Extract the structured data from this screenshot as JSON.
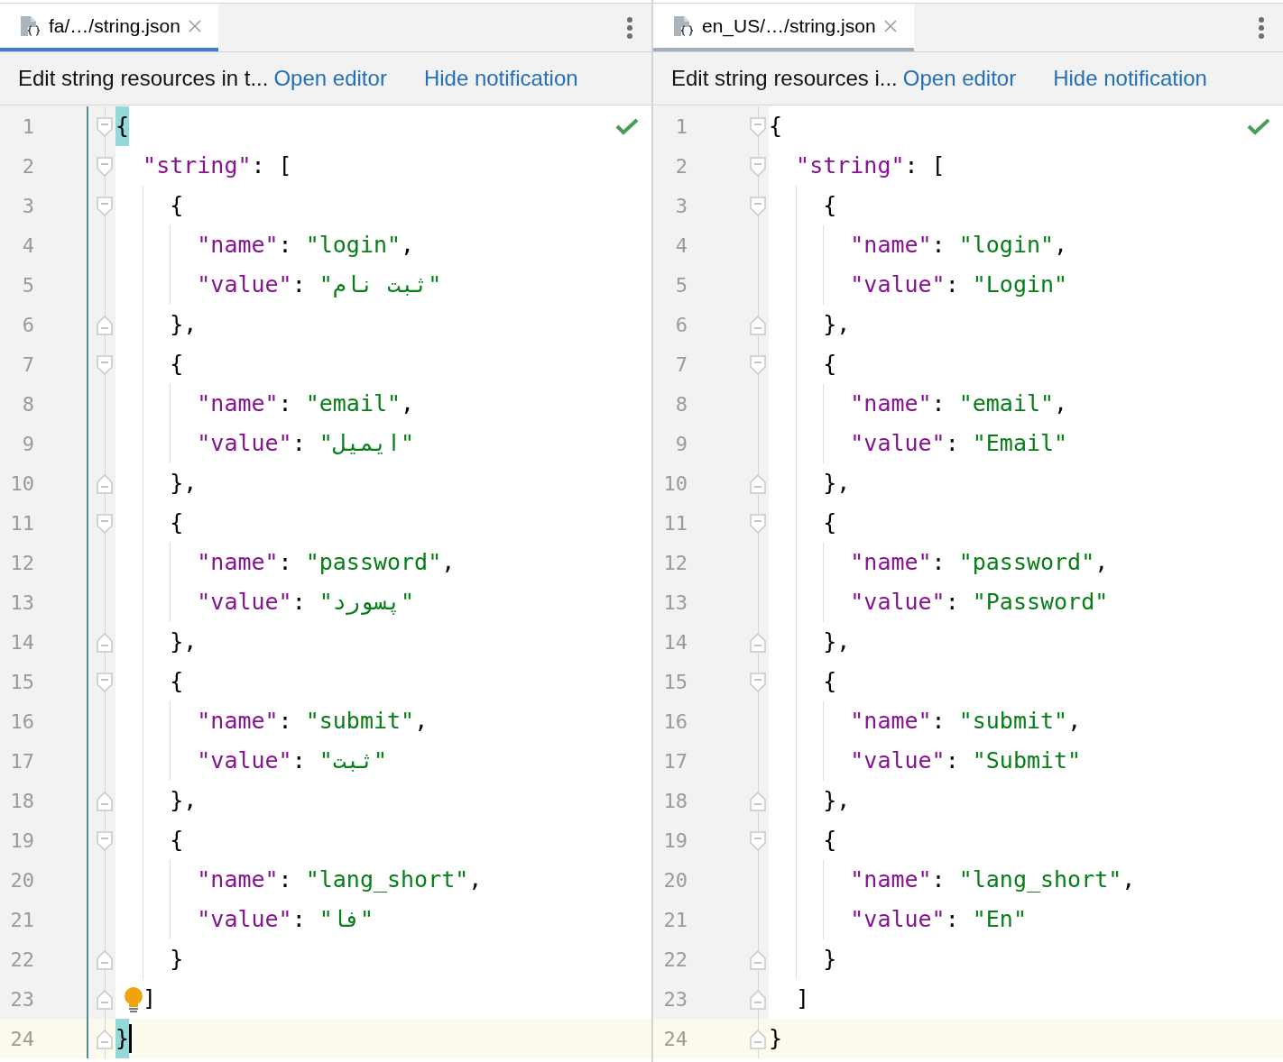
{
  "panes": [
    {
      "focused": true,
      "vcs_marker": true,
      "inspection_ok": true,
      "tab": {
        "label": "fa/…/string.json",
        "selected": true
      },
      "notification": {
        "text": "Edit string resources in t...",
        "links": [
          "Open editor",
          "Hide notification"
        ]
      },
      "lines": [
        {
          "number": "1",
          "fold_start": true,
          "tokens": [
            {
              "kind": "punct",
              "text": "{",
              "matched": true
            }
          ]
        },
        {
          "number": "2",
          "fold_start": true,
          "tokens": [
            {
              "kind": "key",
              "text": "\"string\""
            },
            {
              "kind": "punct",
              "text": ": ["
            }
          ]
        },
        {
          "number": "3",
          "fold_start": true,
          "tokens": [
            {
              "kind": "punct",
              "text": "{"
            }
          ]
        },
        {
          "number": "4",
          "tokens": [
            {
              "kind": "key",
              "text": "\"name\""
            },
            {
              "kind": "punct",
              "text": ": "
            },
            {
              "kind": "string",
              "text": "\"login\""
            },
            {
              "kind": "punct",
              "text": ","
            }
          ]
        },
        {
          "number": "5",
          "tokens": [
            {
              "kind": "key",
              "text": "\"value\""
            },
            {
              "kind": "punct",
              "text": ": "
            },
            {
              "kind": "string",
              "text": "\"ثبت نام\""
            }
          ]
        },
        {
          "number": "6",
          "fold_end": true,
          "tokens": [
            {
              "kind": "punct",
              "text": "},"
            }
          ]
        },
        {
          "number": "7",
          "fold_start": true,
          "tokens": [
            {
              "kind": "punct",
              "text": "{"
            }
          ]
        },
        {
          "number": "8",
          "tokens": [
            {
              "kind": "key",
              "text": "\"name\""
            },
            {
              "kind": "punct",
              "text": ": "
            },
            {
              "kind": "string",
              "text": "\"email\""
            },
            {
              "kind": "punct",
              "text": ","
            }
          ]
        },
        {
          "number": "9",
          "tokens": [
            {
              "kind": "key",
              "text": "\"value\""
            },
            {
              "kind": "punct",
              "text": ": "
            },
            {
              "kind": "string",
              "text": "\"ایمیل\""
            }
          ]
        },
        {
          "number": "10",
          "fold_end": true,
          "tokens": [
            {
              "kind": "punct",
              "text": "},"
            }
          ]
        },
        {
          "number": "11",
          "fold_start": true,
          "tokens": [
            {
              "kind": "punct",
              "text": "{"
            }
          ]
        },
        {
          "number": "12",
          "tokens": [
            {
              "kind": "key",
              "text": "\"name\""
            },
            {
              "kind": "punct",
              "text": ": "
            },
            {
              "kind": "string",
              "text": "\"password\""
            },
            {
              "kind": "punct",
              "text": ","
            }
          ]
        },
        {
          "number": "13",
          "tokens": [
            {
              "kind": "key",
              "text": "\"value\""
            },
            {
              "kind": "punct",
              "text": ": "
            },
            {
              "kind": "string",
              "text": "\"پسورد\""
            }
          ]
        },
        {
          "number": "14",
          "fold_end": true,
          "tokens": [
            {
              "kind": "punct",
              "text": "},"
            }
          ]
        },
        {
          "number": "15",
          "fold_start": true,
          "tokens": [
            {
              "kind": "punct",
              "text": "{"
            }
          ]
        },
        {
          "number": "16",
          "tokens": [
            {
              "kind": "key",
              "text": "\"name\""
            },
            {
              "kind": "punct",
              "text": ": "
            },
            {
              "kind": "string",
              "text": "\"submit\""
            },
            {
              "kind": "punct",
              "text": ","
            }
          ]
        },
        {
          "number": "17",
          "tokens": [
            {
              "kind": "key",
              "text": "\"value\""
            },
            {
              "kind": "punct",
              "text": ": "
            },
            {
              "kind": "string",
              "text": "\"ثبت\""
            }
          ]
        },
        {
          "number": "18",
          "fold_end": true,
          "tokens": [
            {
              "kind": "punct",
              "text": "},"
            }
          ]
        },
        {
          "number": "19",
          "fold_start": true,
          "tokens": [
            {
              "kind": "punct",
              "text": "{"
            }
          ]
        },
        {
          "number": "20",
          "tokens": [
            {
              "kind": "key",
              "text": "\"name\""
            },
            {
              "kind": "punct",
              "text": ": "
            },
            {
              "kind": "string",
              "text": "\"lang_short\""
            },
            {
              "kind": "punct",
              "text": ","
            }
          ]
        },
        {
          "number": "21",
          "tokens": [
            {
              "kind": "key",
              "text": "\"value\""
            },
            {
              "kind": "punct",
              "text": ": "
            },
            {
              "kind": "string",
              "text": "\"فا\""
            }
          ]
        },
        {
          "number": "22",
          "fold_end": true,
          "tokens": [
            {
              "kind": "punct",
              "text": "}"
            }
          ]
        },
        {
          "number": "23",
          "fold_end": true,
          "bulb": true,
          "tokens": [
            {
              "kind": "punct",
              "text": "]"
            }
          ]
        },
        {
          "number": "24",
          "fold_end": true,
          "current": true,
          "caret": true,
          "tokens": [
            {
              "kind": "punct",
              "text": "}",
              "matched": true
            }
          ]
        }
      ]
    },
    {
      "focused": false,
      "vcs_marker": false,
      "inspection_ok": true,
      "tab": {
        "label": "en_US/…/string.json",
        "selected": true
      },
      "notification": {
        "text": "Edit string resources i...",
        "links": [
          "Open editor",
          "Hide notification"
        ]
      },
      "lines": [
        {
          "number": "1",
          "fold_start": true,
          "tokens": [
            {
              "kind": "punct",
              "text": "{"
            }
          ]
        },
        {
          "number": "2",
          "fold_start": true,
          "tokens": [
            {
              "kind": "key",
              "text": "\"string\""
            },
            {
              "kind": "punct",
              "text": ": ["
            }
          ]
        },
        {
          "number": "3",
          "fold_start": true,
          "tokens": [
            {
              "kind": "punct",
              "text": "{"
            }
          ]
        },
        {
          "number": "4",
          "tokens": [
            {
              "kind": "key",
              "text": "\"name\""
            },
            {
              "kind": "punct",
              "text": ": "
            },
            {
              "kind": "string",
              "text": "\"login\""
            },
            {
              "kind": "punct",
              "text": ","
            }
          ]
        },
        {
          "number": "5",
          "tokens": [
            {
              "kind": "key",
              "text": "\"value\""
            },
            {
              "kind": "punct",
              "text": ": "
            },
            {
              "kind": "string",
              "text": "\"Login\""
            }
          ]
        },
        {
          "number": "6",
          "fold_end": true,
          "tokens": [
            {
              "kind": "punct",
              "text": "},"
            }
          ]
        },
        {
          "number": "7",
          "fold_start": true,
          "tokens": [
            {
              "kind": "punct",
              "text": "{"
            }
          ]
        },
        {
          "number": "8",
          "tokens": [
            {
              "kind": "key",
              "text": "\"name\""
            },
            {
              "kind": "punct",
              "text": ": "
            },
            {
              "kind": "string",
              "text": "\"email\""
            },
            {
              "kind": "punct",
              "text": ","
            }
          ]
        },
        {
          "number": "9",
          "tokens": [
            {
              "kind": "key",
              "text": "\"value\""
            },
            {
              "kind": "punct",
              "text": ": "
            },
            {
              "kind": "string",
              "text": "\"Email\""
            }
          ]
        },
        {
          "number": "10",
          "fold_end": true,
          "tokens": [
            {
              "kind": "punct",
              "text": "},"
            }
          ]
        },
        {
          "number": "11",
          "fold_start": true,
          "tokens": [
            {
              "kind": "punct",
              "text": "{"
            }
          ]
        },
        {
          "number": "12",
          "tokens": [
            {
              "kind": "key",
              "text": "\"name\""
            },
            {
              "kind": "punct",
              "text": ": "
            },
            {
              "kind": "string",
              "text": "\"password\""
            },
            {
              "kind": "punct",
              "text": ","
            }
          ]
        },
        {
          "number": "13",
          "tokens": [
            {
              "kind": "key",
              "text": "\"value\""
            },
            {
              "kind": "punct",
              "text": ": "
            },
            {
              "kind": "string",
              "text": "\"Password\""
            }
          ]
        },
        {
          "number": "14",
          "fold_end": true,
          "tokens": [
            {
              "kind": "punct",
              "text": "},"
            }
          ]
        },
        {
          "number": "15",
          "fold_start": true,
          "tokens": [
            {
              "kind": "punct",
              "text": "{"
            }
          ]
        },
        {
          "number": "16",
          "tokens": [
            {
              "kind": "key",
              "text": "\"name\""
            },
            {
              "kind": "punct",
              "text": ": "
            },
            {
              "kind": "string",
              "text": "\"submit\""
            },
            {
              "kind": "punct",
              "text": ","
            }
          ]
        },
        {
          "number": "17",
          "tokens": [
            {
              "kind": "key",
              "text": "\"value\""
            },
            {
              "kind": "punct",
              "text": ": "
            },
            {
              "kind": "string",
              "text": "\"Submit\""
            }
          ]
        },
        {
          "number": "18",
          "fold_end": true,
          "tokens": [
            {
              "kind": "punct",
              "text": "},"
            }
          ]
        },
        {
          "number": "19",
          "fold_start": true,
          "tokens": [
            {
              "kind": "punct",
              "text": "{"
            }
          ]
        },
        {
          "number": "20",
          "tokens": [
            {
              "kind": "key",
              "text": "\"name\""
            },
            {
              "kind": "punct",
              "text": ": "
            },
            {
              "kind": "string",
              "text": "\"lang_short\""
            },
            {
              "kind": "punct",
              "text": ","
            }
          ]
        },
        {
          "number": "21",
          "tokens": [
            {
              "kind": "key",
              "text": "\"value\""
            },
            {
              "kind": "punct",
              "text": ": "
            },
            {
              "kind": "string",
              "text": "\"En\""
            }
          ]
        },
        {
          "number": "22",
          "fold_end": true,
          "tokens": [
            {
              "kind": "punct",
              "text": "}"
            }
          ]
        },
        {
          "number": "23",
          "fold_end": true,
          "tokens": [
            {
              "kind": "punct",
              "text": "]"
            }
          ]
        },
        {
          "number": "24",
          "fold_end": true,
          "current": true,
          "tokens": [
            {
              "kind": "punct",
              "text": "}"
            }
          ]
        }
      ]
    }
  ]
}
